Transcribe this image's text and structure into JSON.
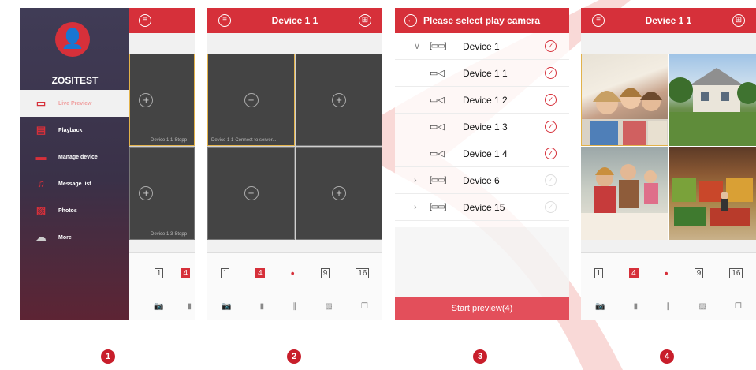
{
  "panel1": {
    "user_name": "ZOSITEST",
    "menu": [
      {
        "label": "Live Preview",
        "icon": "video-camera-icon"
      },
      {
        "label": "Playback",
        "icon": "film-icon"
      },
      {
        "label": "Manage device",
        "icon": "dvr-icon"
      },
      {
        "label": "Message list",
        "icon": "bell-icon"
      },
      {
        "label": "Photos",
        "icon": "image-icon"
      },
      {
        "label": "More",
        "icon": "cloud-icon"
      }
    ],
    "cell_labels": [
      "Device 1 1-Stopp",
      "Device 1 3-Stopp"
    ],
    "layout_numbers": [
      "1",
      "4"
    ]
  },
  "panel2": {
    "title": "Device 1 1",
    "cell_label": "Device 1 1-Connect to server...",
    "layout_numbers": [
      "1",
      "4",
      "•",
      "9",
      "16"
    ]
  },
  "panel3": {
    "title": "Please select play camera",
    "rows": [
      {
        "label": "Device 1",
        "type": "dvr",
        "expanded": true,
        "checked": true
      },
      {
        "label": "Device 1 1",
        "type": "camera",
        "checked": true
      },
      {
        "label": "Device 1 2",
        "type": "camera",
        "checked": true
      },
      {
        "label": "Device 1 3",
        "type": "camera",
        "checked": true
      },
      {
        "label": "Device 1 4",
        "type": "camera",
        "checked": true
      },
      {
        "label": "Device 6",
        "type": "dvr",
        "expanded": false,
        "checked": false
      },
      {
        "label": "Device 15",
        "type": "dvr",
        "expanded": false,
        "checked": false
      }
    ],
    "start_button": "Start preview(4)"
  },
  "panel4": {
    "title": "Device 1 1",
    "layout_numbers": [
      "1",
      "4",
      "•",
      "9",
      "16"
    ]
  },
  "steps": [
    "1",
    "2",
    "3",
    "4"
  ],
  "colors": {
    "accent": "#d6303a",
    "sidebar_top": "#403c56",
    "sidebar_bottom": "#5d2434"
  }
}
